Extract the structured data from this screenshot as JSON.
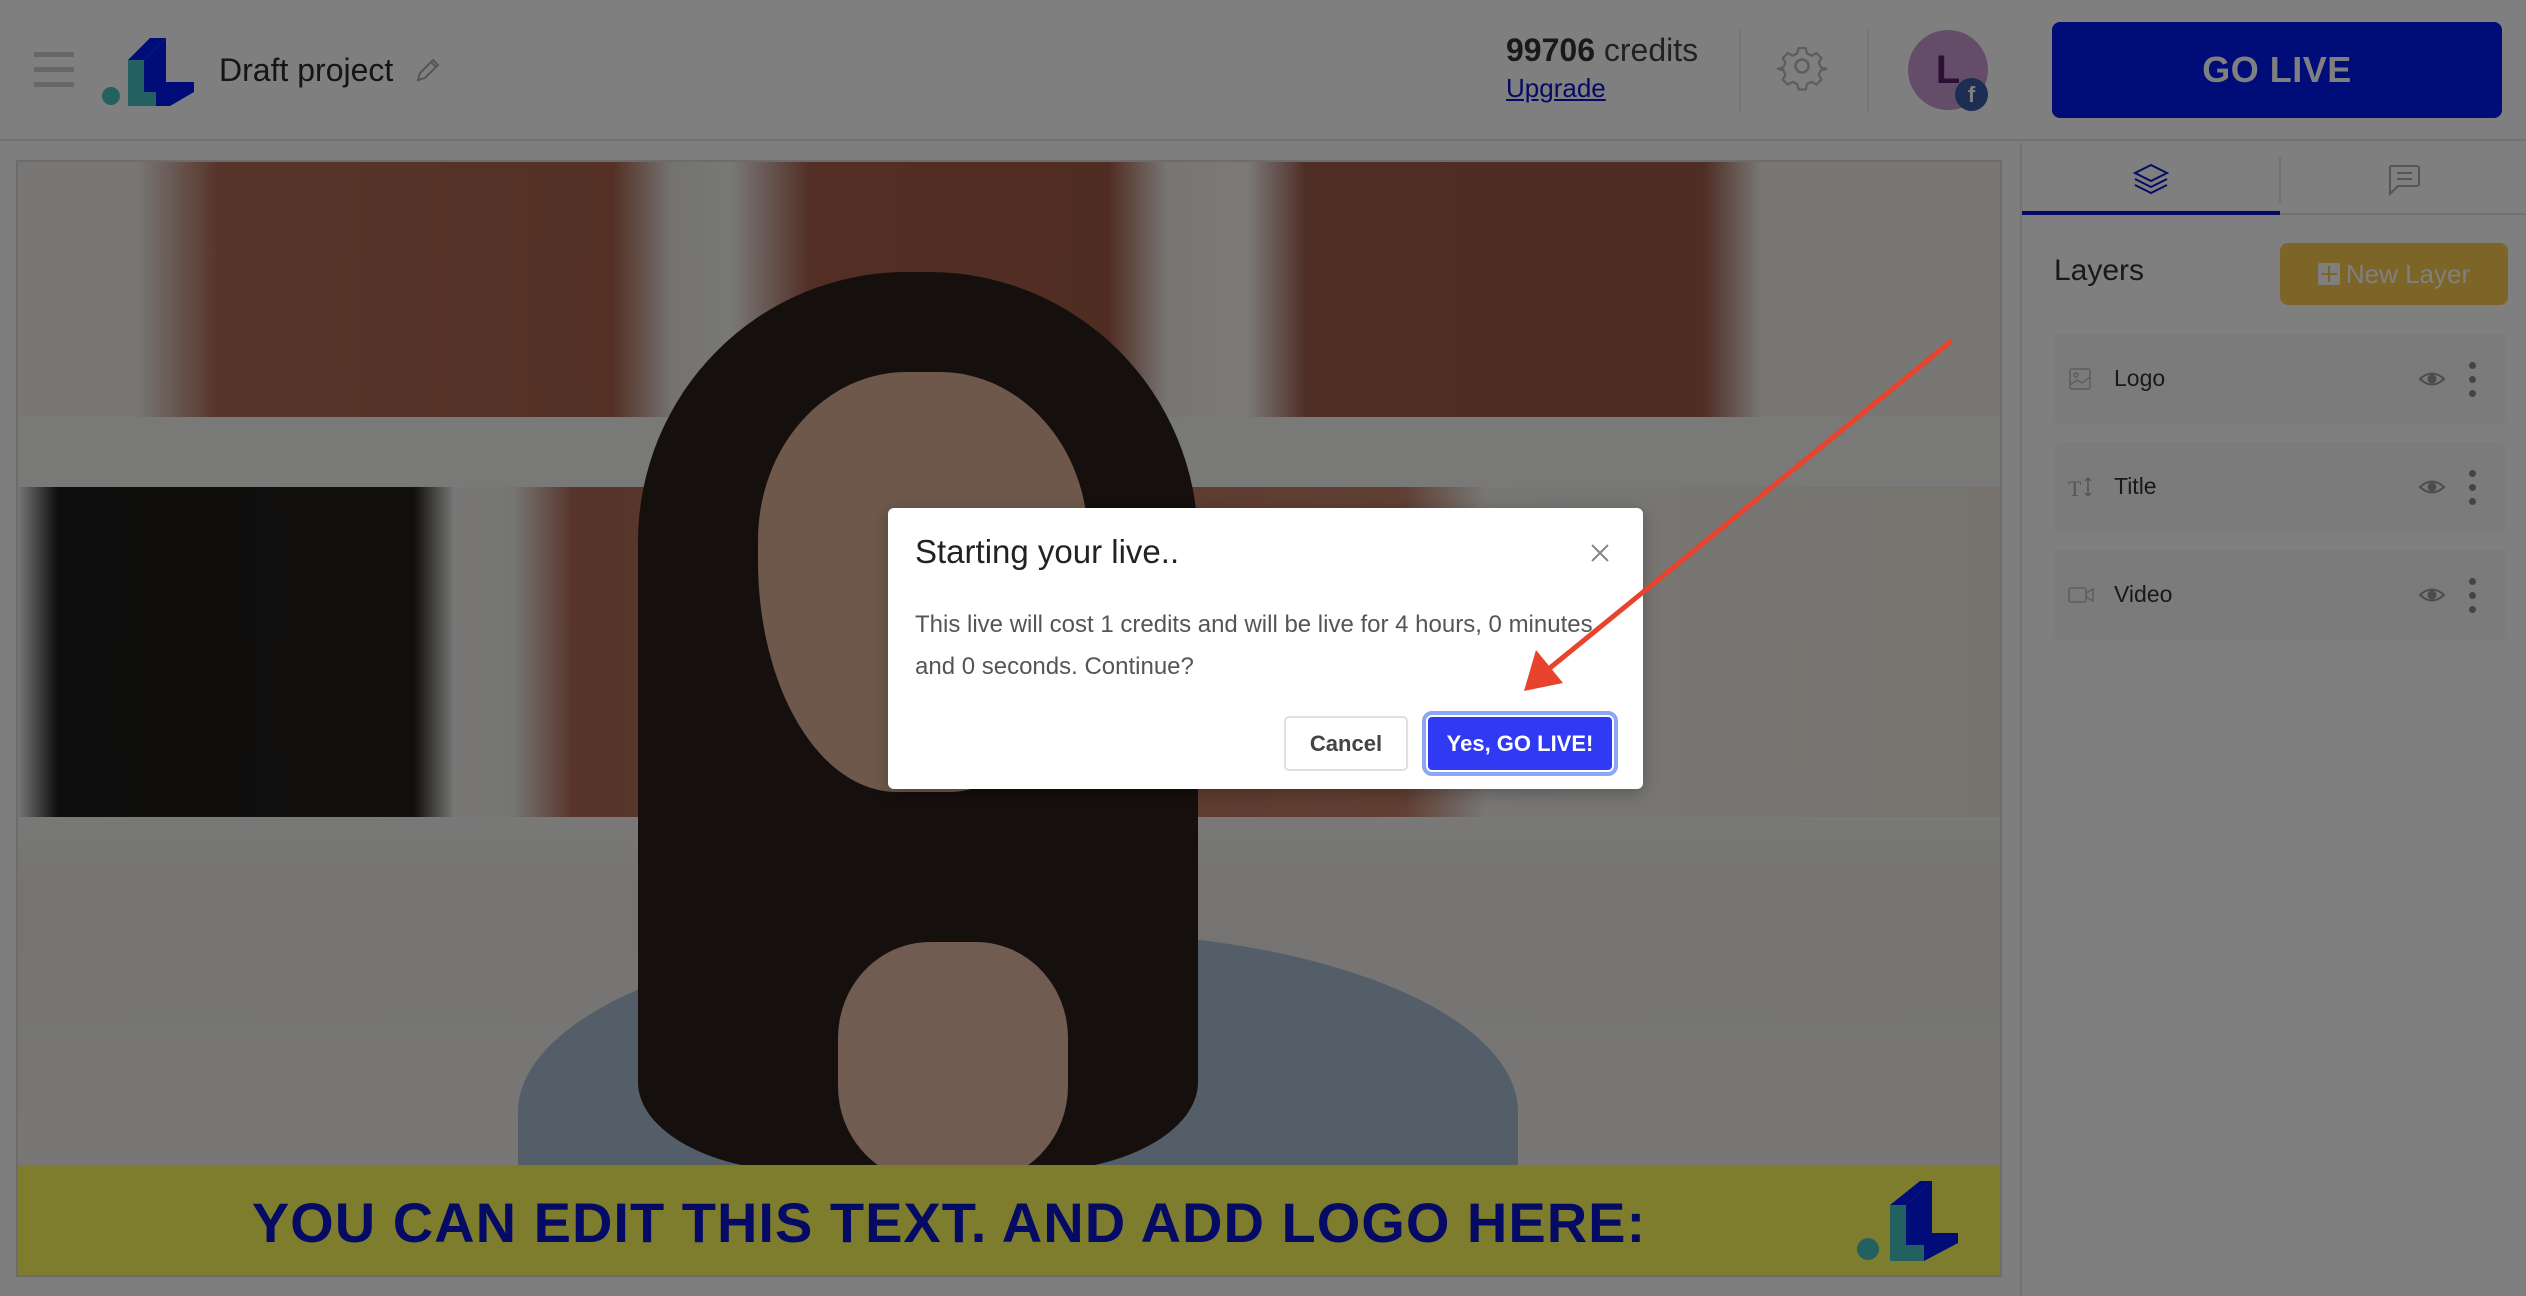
{
  "header": {
    "menu_icon": "hamburger-icon",
    "project_title": "Draft project",
    "edit_icon": "pencil-icon",
    "credits_amount": "99706",
    "credits_label": "credits",
    "upgrade_label": "Upgrade",
    "settings_icon": "gear-icon",
    "avatar_initial": "L",
    "avatar_badge": "f",
    "go_live_label": "GO LIVE"
  },
  "canvas": {
    "banner_text": "YOU CAN EDIT THIS TEXT. AND ADD LOGO HERE:"
  },
  "panel": {
    "tabs": [
      {
        "name": "layers",
        "icon": "layers-icon",
        "active": true
      },
      {
        "name": "chat",
        "icon": "chat-icon",
        "active": false
      }
    ],
    "title": "Layers",
    "new_layer_label": "New Layer",
    "layers": [
      {
        "label": "Logo",
        "icon": "image-icon"
      },
      {
        "label": "Title",
        "icon": "text-icon"
      },
      {
        "label": "Video",
        "icon": "video-camera-icon"
      }
    ]
  },
  "modal": {
    "title": "Starting your live..",
    "body": "This live will cost 1 credits and will be live for 4 hours, 0 minutes and 0 seconds. Continue?",
    "cancel_label": "Cancel",
    "confirm_label": "Yes, GO LIVE!"
  },
  "colors": {
    "brand_blue": "#0018ee",
    "confirm_blue": "#2f3af2",
    "new_layer_yellow": "#fbcb50",
    "banner_yellow": "#fdfa5d",
    "banner_text": "#0a17c9",
    "annotation_arrow": "#e8432c"
  }
}
